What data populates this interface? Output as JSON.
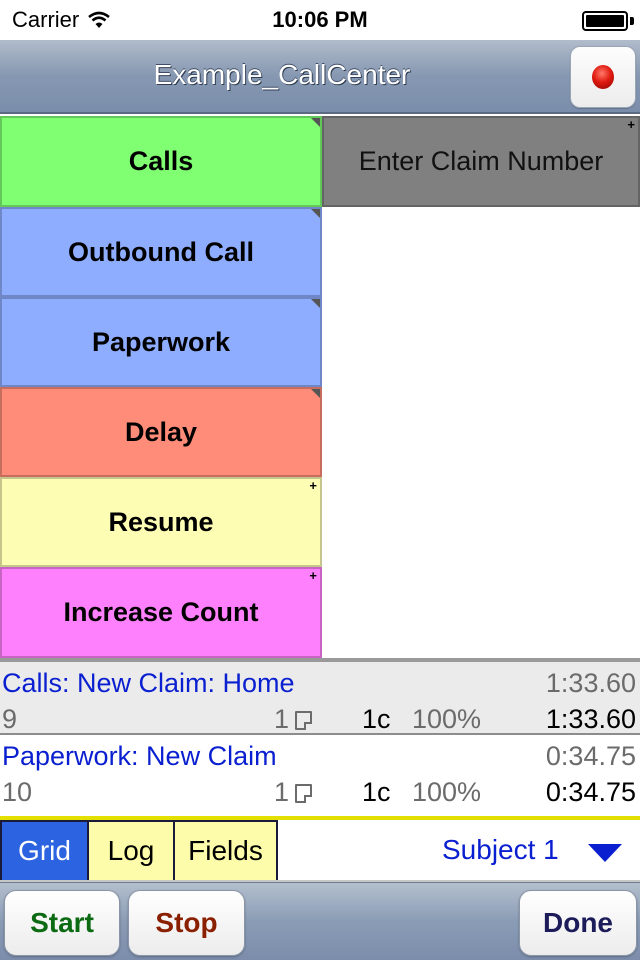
{
  "status_bar": {
    "carrier": "Carrier",
    "time": "10:06 PM",
    "wifi_icon": "wifi-icon",
    "battery_icon": "battery-icon",
    "battery_level": 1.0
  },
  "nav": {
    "title": "Example_CallCenter",
    "record_button_icon": "record-dot-icon"
  },
  "grid": {
    "buttons": [
      {
        "label": "Calls",
        "color": "#80ff72",
        "marker": "triangle"
      },
      {
        "label": "Enter Claim Number",
        "color": "#808080",
        "marker": "plus"
      },
      {
        "label": "Outbound Call",
        "color": "#8fadff",
        "marker": "triangle"
      },
      {
        "label": "Paperwork",
        "color": "#8fadff",
        "marker": "triangle"
      },
      {
        "label": "Delay",
        "color": "#ff8c78",
        "marker": "triangle"
      },
      {
        "label": "Resume",
        "color": "#fdfdb4",
        "marker": "plus"
      },
      {
        "label": "Increase Count",
        "color": "#ff80fc",
        "marker": "plus"
      }
    ],
    "plus_glyph": "+"
  },
  "log": {
    "items": [
      {
        "title": "Calls: New Claim: Home",
        "time_top": "1:33.60",
        "index": "9",
        "count": "1",
        "note_icon": "note-icon",
        "c_value": "1c",
        "percent": "100%",
        "time_bottom": "1:33.60"
      },
      {
        "title": "Paperwork: New Claim",
        "time_top": "0:34.75",
        "index": "10",
        "count": "1",
        "note_icon": "note-icon",
        "c_value": "1c",
        "percent": "100%",
        "time_bottom": "0:34.75"
      }
    ]
  },
  "tabs": {
    "items": [
      {
        "label": "Grid",
        "active": true
      },
      {
        "label": "Log",
        "active": false
      },
      {
        "label": "Fields",
        "active": false
      }
    ],
    "subject": "Subject 1",
    "subject_dropdown_icon": "triangle-down-icon"
  },
  "toolbar": {
    "start_label": "Start",
    "stop_label": "Stop",
    "done_label": "Done",
    "colors": {
      "start": "#0b6a12",
      "stop": "#8a2000",
      "done": "#1c1c5a"
    }
  }
}
